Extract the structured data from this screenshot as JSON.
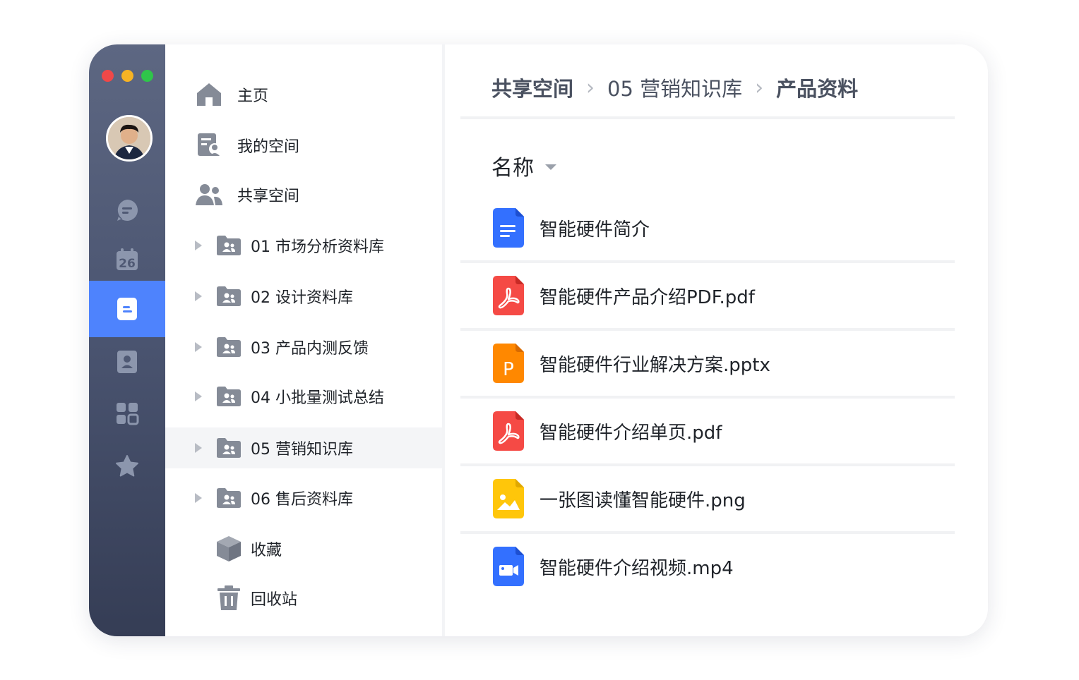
{
  "window": {
    "controls": [
      "close",
      "minimize",
      "maximize"
    ]
  },
  "colors": {
    "accent": "#4e83fd",
    "close": "#f04848",
    "minimize": "#f7b324",
    "maximize": "#2fc54a",
    "doc": "#3370ff",
    "pdf": "#f54a45",
    "ppt": "#ff8800",
    "image": "#ffc60a",
    "video": "#3370ff"
  },
  "rail": {
    "items": [
      {
        "icon": "chat-icon"
      },
      {
        "icon": "calendar-icon",
        "text": "26"
      },
      {
        "icon": "document-icon",
        "active": true
      },
      {
        "icon": "contacts-icon"
      },
      {
        "icon": "apps-grid-icon"
      },
      {
        "icon": "star-icon"
      }
    ]
  },
  "tree": {
    "home": "主页",
    "my_space": "我的空间",
    "shared_space": "共享空间",
    "folders": [
      {
        "label": "01 市场分析资料库"
      },
      {
        "label": "02 设计资料库"
      },
      {
        "label": "03 产品内测反馈"
      },
      {
        "label": "04 小批量测试总结"
      },
      {
        "label": "05 营销知识库",
        "selected": true
      },
      {
        "label": "06 售后资料库"
      }
    ],
    "favorites": "收藏",
    "trash": "回收站"
  },
  "breadcrumb": [
    "共享空间",
    "05 营销知识库",
    "产品资料"
  ],
  "list": {
    "column": "名称",
    "files": [
      {
        "name": "智能硬件简介",
        "type": "doc",
        "icon": "doc-file-icon"
      },
      {
        "name": "智能硬件产品介绍PDF.pdf",
        "type": "pdf",
        "icon": "pdf-file-icon"
      },
      {
        "name": "智能硬件行业解决方案.pptx",
        "type": "ppt",
        "icon": "ppt-file-icon",
        "glyph": "P"
      },
      {
        "name": "智能硬件介绍单页.pdf",
        "type": "pdf",
        "icon": "pdf-file-icon"
      },
      {
        "name": "一张图读懂智能硬件.png",
        "type": "image",
        "icon": "image-file-icon"
      },
      {
        "name": "智能硬件介绍视频.mp4",
        "type": "video",
        "icon": "video-file-icon"
      }
    ]
  }
}
